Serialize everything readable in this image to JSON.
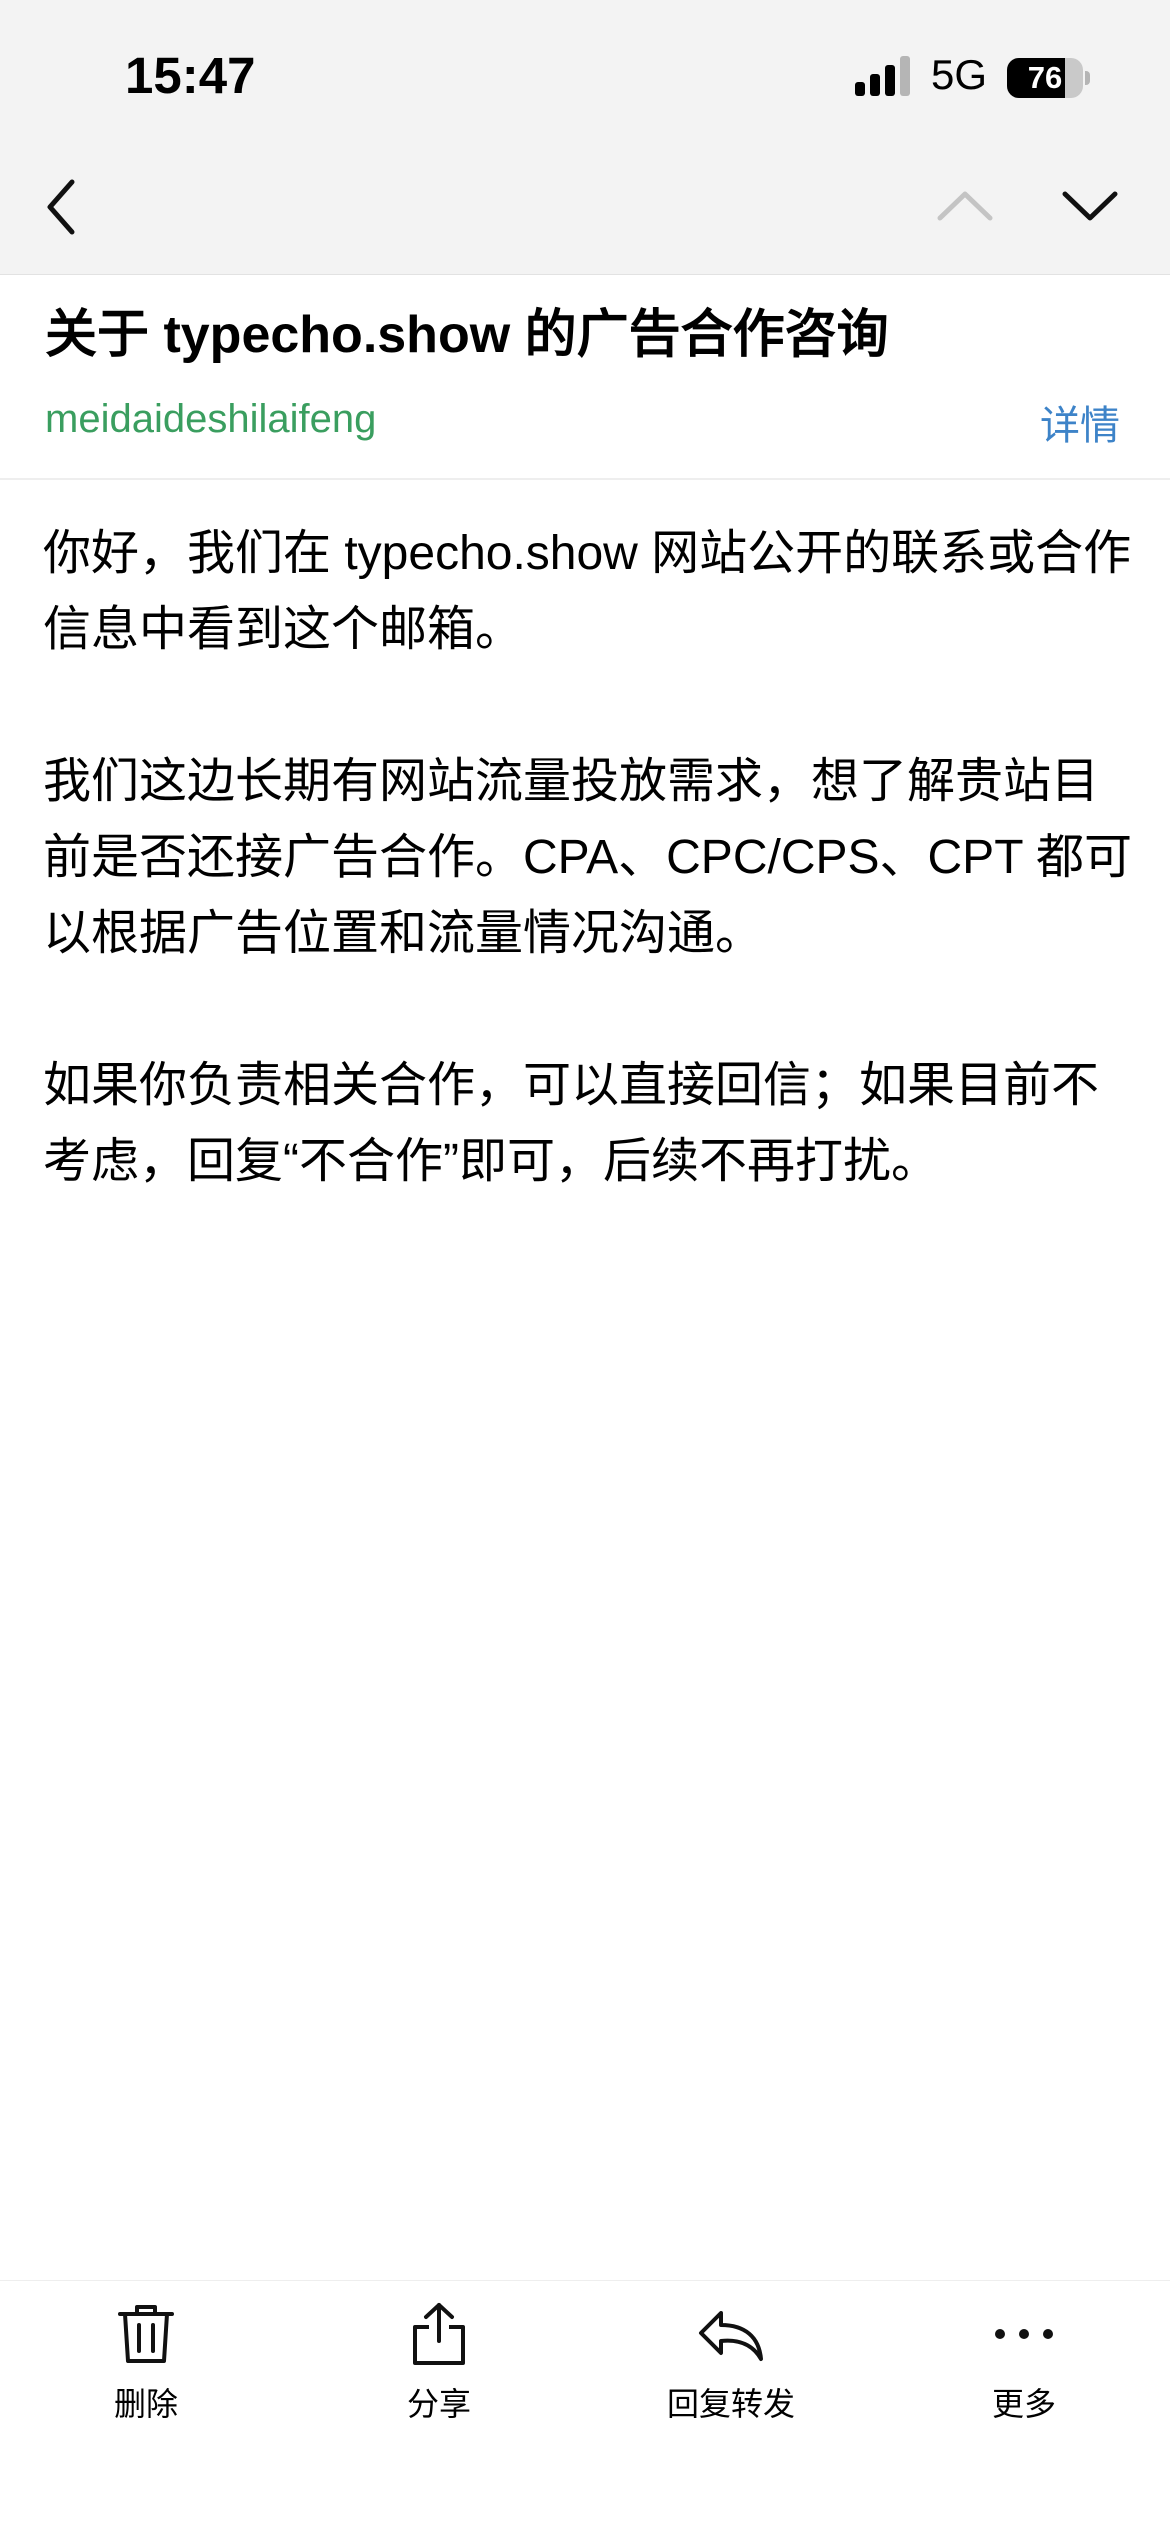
{
  "status_bar": {
    "time": "15:47",
    "network": "5G",
    "battery": 76,
    "battery_label": "76"
  },
  "nav": {
    "back_icon": "chevron-left-icon",
    "prev_icon": "chevron-up-icon",
    "next_icon": "chevron-down-icon"
  },
  "email": {
    "subject": "关于 typecho.show 的广告合作咨询",
    "sender": "meidaideshilaifeng",
    "details_label": "详情",
    "body": [
      "你好，我们在 typecho.show 网站公开的联系或合作信息中看到这个邮箱。",
      "我们这边长期有网站流量投放需求，想了解贵站目前是否还接广告合作。CPA、CPC/CPS、CPT 都可以根据广告位置和流量情况沟通。",
      "如果你负责相关合作，可以直接回信；如果目前不考虑，回复“不合作”即可，后续不再打扰。"
    ]
  },
  "toolbar": {
    "delete_label": "删除",
    "share_label": "分享",
    "reply_label": "回复转发",
    "more_label": "更多"
  },
  "colors": {
    "sender": "#3a9e5f",
    "link": "#3d83c8",
    "bar_background": "#f3f3f3"
  }
}
